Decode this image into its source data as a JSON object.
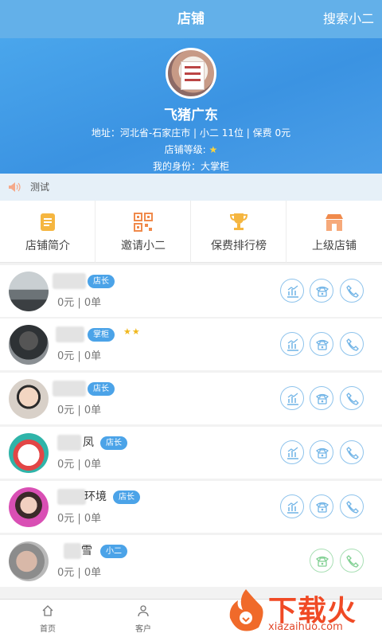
{
  "header": {
    "title": "店铺",
    "search_label": "搜索小二"
  },
  "store": {
    "name": "飞猪广东",
    "address_line": "地址：河北省-石家庄市 | 小二 11位 | 保费 0元",
    "level_label": "店铺等级:",
    "level_stars": "★",
    "identity_line": "我的身份：大掌柜"
  },
  "notice": {
    "text": "测试",
    "icon": "speaker-icon"
  },
  "menu": [
    {
      "label": "店铺简介",
      "icon": "document-icon",
      "color": "#f5b640"
    },
    {
      "label": "邀请小二",
      "icon": "qrcode-icon",
      "color": "#f08a4b"
    },
    {
      "label": "保费排行榜",
      "icon": "trophy-icon",
      "color": "#f5b640"
    },
    {
      "label": "上级店铺",
      "icon": "shop-icon",
      "color": "#f08a4b"
    }
  ],
  "members": [
    {
      "name": "",
      "badge": "店长",
      "stars": "",
      "stats": "0元 | 0单",
      "avatar": "landscape-avatar"
    },
    {
      "name": "",
      "badge": "掌柜",
      "stars": "★★",
      "stats": "0元 | 0单",
      "avatar": "dark-avatar"
    },
    {
      "name": "",
      "badge": "店长",
      "stars": "",
      "stats": "0元 | 0单",
      "avatar": "glasses-avatar"
    },
    {
      "name": "凤",
      "badge": "店长",
      "stars": "",
      "stats": "0元 | 0单",
      "avatar": "snowman-avatar"
    },
    {
      "name": "环境",
      "badge": "店长",
      "stars": "",
      "stats": "0元 | 0单",
      "avatar": "girl-avatar"
    },
    {
      "name": "雪",
      "badge": "小二",
      "stars": "",
      "stats": "0元 | 0单",
      "avatar": "hand-avatar"
    }
  ],
  "tabs": [
    {
      "label": "首页",
      "icon": "home-icon"
    },
    {
      "label": "客户",
      "icon": "customers-icon"
    }
  ],
  "watermark": {
    "cn": "下载火",
    "en": "xiazaihuo.com"
  },
  "colors": {
    "primary": "#63b0e9",
    "badge": "#4ba3e8",
    "watermark": "#f04a25"
  }
}
